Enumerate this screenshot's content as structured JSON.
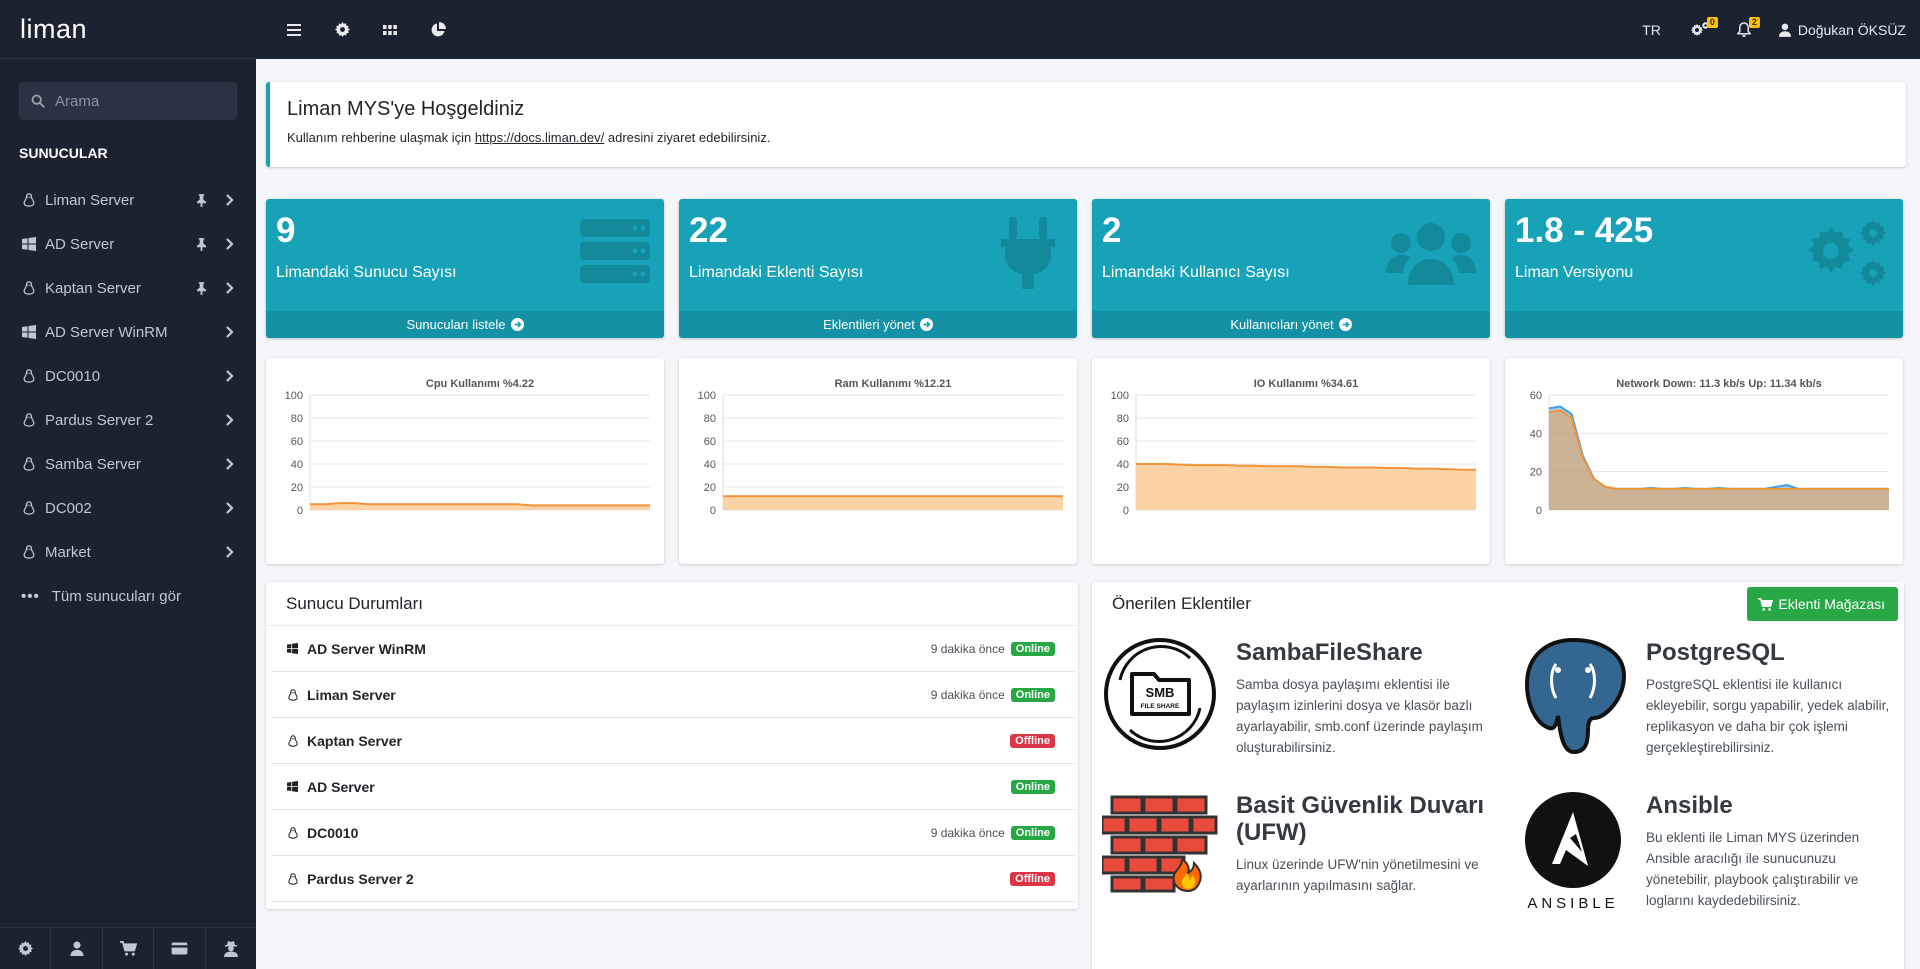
{
  "brand": "liman",
  "sidebar": {
    "search_placeholder": "Arama",
    "header": "SUNUCULAR",
    "items": [
      {
        "label": "Liman Server",
        "os": "linux",
        "pinned": true
      },
      {
        "label": "AD Server",
        "os": "windows",
        "pinned": true
      },
      {
        "label": "Kaptan Server",
        "os": "linux",
        "pinned": true
      },
      {
        "label": "AD Server WinRM",
        "os": "windows",
        "pinned": false
      },
      {
        "label": "DC0010",
        "os": "linux",
        "pinned": false
      },
      {
        "label": "Pardus Server 2",
        "os": "linux",
        "pinned": false
      },
      {
        "label": "Samba Server",
        "os": "linux",
        "pinned": false
      },
      {
        "label": "DC002",
        "os": "linux",
        "pinned": false
      },
      {
        "label": "Market",
        "os": "linux",
        "pinned": false
      }
    ],
    "all_servers": "Tüm sunucuları gör",
    "footer_icons": [
      "gear-icon",
      "user-icon",
      "cart-icon",
      "card-icon",
      "user-secret-icon"
    ]
  },
  "topbar": {
    "icons": [
      "menu-icon",
      "gear-icon",
      "grid-icon",
      "chart-pie-icon"
    ],
    "lang": "TR",
    "settings_badge": "0",
    "notifications_badge": "2",
    "user_name": "Doğukan ÖKSÜZ"
  },
  "welcome": {
    "title": "Liman MYS'ye Hoşgeldiniz",
    "text_before": "Kullanım rehberine ulaşmak için",
    "link": "https://docs.liman.dev/",
    "text_after": "adresini ziyaret edebilirsiniz."
  },
  "stats": [
    {
      "value": "9",
      "label": "Limandaki Sunucu Sayısı",
      "footer": "Sunucuları listele",
      "icon": "server-icon"
    },
    {
      "value": "22",
      "label": "Limandaki Eklenti Sayısı",
      "footer": "Eklentileri yönet",
      "icon": "plug-icon"
    },
    {
      "value": "2",
      "label": "Limandaki Kullanıcı Sayısı",
      "footer": "Kullanıcıları yönet",
      "icon": "users-icon"
    },
    {
      "value": "1.8 - 425",
      "label": "Liman Versiyonu",
      "footer": "",
      "icon": "cogs-icon"
    }
  ],
  "colors": {
    "accent": "#17a2b8",
    "sidebar": "#1b2331",
    "success": "#28a745",
    "danger": "#dc3545",
    "warning": "#ffc107",
    "chart_line": "#f0943a",
    "chart_fill": "#fcd3a6",
    "chart_line_2": "#3c9ee5"
  },
  "chart_data": [
    {
      "type": "area",
      "title": "Cpu Kullanımı %4.22",
      "ylim": [
        0,
        100
      ],
      "yticks": [
        0,
        20,
        40,
        60,
        80,
        100
      ],
      "series": [
        {
          "values": [
            5,
            5,
            6,
            6,
            5,
            5,
            5,
            5,
            5,
            5,
            5,
            5,
            5,
            5,
            5,
            4,
            4,
            4,
            4,
            4,
            4,
            4,
            4,
            4
          ]
        }
      ]
    },
    {
      "type": "area",
      "title": "Ram Kullanımı %12.21",
      "ylim": [
        0,
        100
      ],
      "yticks": [
        0,
        20,
        40,
        60,
        80,
        100
      ],
      "series": [
        {
          "values": [
            12,
            12,
            12,
            12,
            12,
            12,
            12,
            12,
            12,
            12,
            12,
            12,
            12,
            12,
            12,
            12,
            12,
            12,
            12,
            12,
            12,
            12,
            12,
            12
          ]
        }
      ]
    },
    {
      "type": "area",
      "title": "IO Kullanımı %34.61",
      "ylim": [
        0,
        100
      ],
      "yticks": [
        0,
        20,
        40,
        60,
        80,
        100
      ],
      "series": [
        {
          "values": [
            40,
            40,
            40,
            39.5,
            39,
            39,
            39,
            38.5,
            38.5,
            38,
            38,
            38,
            37.5,
            37.5,
            37,
            37,
            37,
            36.5,
            36.5,
            36,
            36,
            35.5,
            35,
            35
          ]
        }
      ]
    },
    {
      "type": "area",
      "title": "Network Down: 11.3 kb/s Up: 11.34 kb/s",
      "ylim": [
        0,
        60
      ],
      "yticks": [
        0,
        20,
        40,
        60
      ],
      "series": [
        {
          "values": [
            53,
            54,
            50,
            28,
            16,
            12,
            11,
            11,
            11,
            11.5,
            11,
            11,
            11.5,
            11,
            11,
            11.5,
            11,
            11,
            11,
            11,
            12,
            13,
            11,
            11,
            11,
            11,
            11,
            11,
            11,
            11,
            11
          ]
        },
        {
          "values": [
            51,
            52,
            48,
            27,
            16,
            12,
            11,
            11,
            11,
            11,
            11,
            11,
            11,
            11,
            11,
            11,
            11,
            11,
            11,
            11,
            11,
            11,
            11,
            11,
            11,
            11,
            11,
            11,
            11,
            11,
            11
          ]
        }
      ]
    }
  ],
  "servers_panel": {
    "title": "Sunucu Durumları",
    "rows": [
      {
        "name": "AD Server WinRM",
        "os": "windows",
        "time": "9 dakika önce",
        "status": "Online"
      },
      {
        "name": "Liman Server",
        "os": "linux",
        "time": "9 dakika önce",
        "status": "Online"
      },
      {
        "name": "Kaptan Server",
        "os": "linux",
        "time": "",
        "status": "Offline"
      },
      {
        "name": "AD Server",
        "os": "windows",
        "time": "",
        "status": "Online"
      },
      {
        "name": "DC0010",
        "os": "linux",
        "time": "9 dakika önce",
        "status": "Online"
      },
      {
        "name": "Pardus Server 2",
        "os": "linux",
        "time": "",
        "status": "Offline"
      }
    ]
  },
  "extensions_panel": {
    "title": "Önerilen Eklentiler",
    "store_button": "Eklenti Mağazası",
    "items": [
      {
        "title": "SambaFileShare",
        "desc": "Samba dosya paylaşımı eklentisi ile paylaşım izinlerini dosya ve klasör bazlı ayarlayabilir, smb.conf üzerinde paylaşım oluşturabilirsiniz.",
        "logo_text_1": "SMB",
        "logo_text_2": "FILE SHARE"
      },
      {
        "title": "PostgreSQL",
        "desc": "PostgreSQL eklentisi ile kullanıcı ekleyebilir, sorgu yapabilir, yedek alabilir, replikasyon ve daha bir çok işlemi gerçekleştirebilirsiniz."
      },
      {
        "title": "Basit Güvenlik Duvarı (UFW)",
        "desc": "Linux üzerinde UFW'nin yönetilmesini ve ayarlarının yapılmasını sağlar."
      },
      {
        "title": "Ansible",
        "desc": "Bu eklenti ile Liman MYS üzerinden Ansible aracılığı ile sunucunuzu yönetebilir, playbook çalıştırabilir ve loglarını kaydedebilirsiniz.",
        "logo_text": "ANSIBLE"
      }
    ]
  }
}
